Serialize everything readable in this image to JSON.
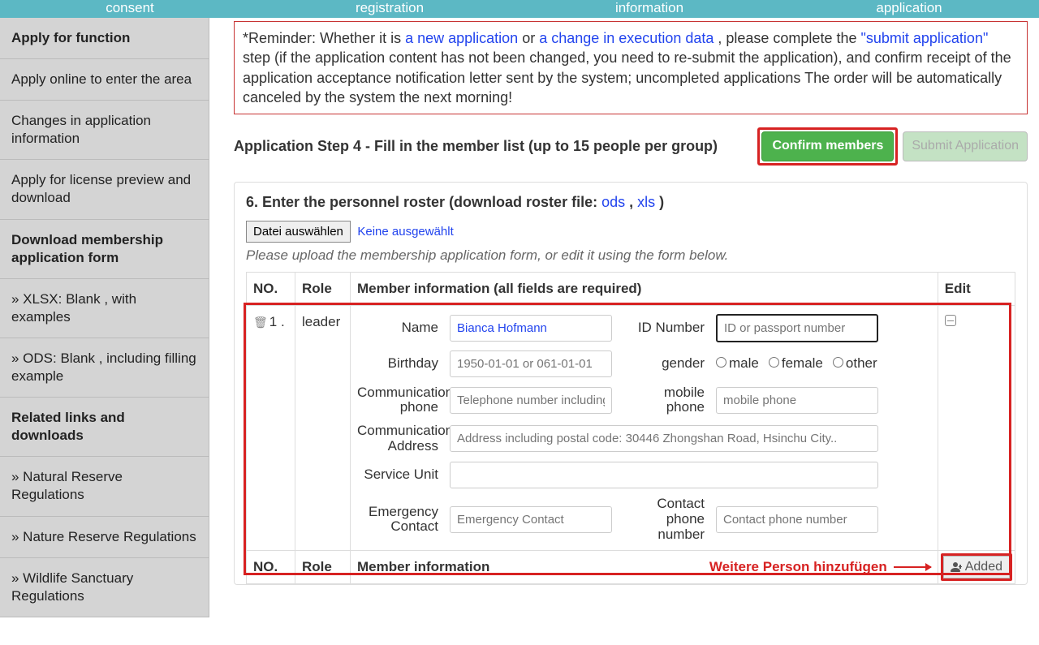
{
  "topbar": [
    "consent",
    "registration",
    "information",
    "application"
  ],
  "sidebar": {
    "items": [
      {
        "label": "Apply for function",
        "bold": true
      },
      {
        "label": "Apply online to enter the area",
        "bold": false
      },
      {
        "label": "Changes in application information",
        "bold": false
      },
      {
        "label": "Apply for license preview and download",
        "bold": false
      },
      {
        "label": "Download membership application form",
        "bold": true
      },
      {
        "label": "» XLSX: Blank , with examples",
        "bold": false
      },
      {
        "label": "» ODS: Blank , including filling example",
        "bold": false
      },
      {
        "label": "Related links and downloads",
        "bold": true
      },
      {
        "label": "» Natural Reserve Regulations",
        "bold": false
      },
      {
        "label": "» Nature Reserve Regulations",
        "bold": false
      },
      {
        "label": "» Wildlife Sanctuary Regulations",
        "bold": false
      }
    ]
  },
  "reminder": {
    "prefix": "*Reminder: Whether it is ",
    "link1": "a new application",
    "mid1": " or ",
    "link2": "a change in execution data",
    "mid2": " , please complete the ",
    "link3": "\"submit application\"",
    "suffix": " step (if the application content has not been changed, you need to re-submit the application), and confirm receipt of the application acceptance notification letter sent by the system; uncompleted applications The order will be automatically canceled by the system the next morning!"
  },
  "step": {
    "title": "Application Step 4 - Fill in the member list (up to 15 people per group)",
    "confirm": "Confirm members",
    "submit": "Submit Application"
  },
  "panel": {
    "title_prefix": "6. Enter the personnel roster (download roster file: ",
    "ods": "ods",
    "sep": " , ",
    "xls": "xls",
    "suffix": " )",
    "file_btn": "Datei auswählen",
    "file_status": "Keine ausgewählt",
    "hint": "Please upload the membership application form, or edit it using the form below."
  },
  "table": {
    "headers": {
      "no": "NO.",
      "role": "Role",
      "info": "Member information (all fields are required)",
      "edit": "Edit"
    },
    "footer_info": "Member information",
    "row": {
      "no": "1 .",
      "role": "leader"
    },
    "labels": {
      "name": "Name",
      "id": "ID Number",
      "birthday": "Birthday",
      "gender": "gender",
      "comm_phone": "Communication phone",
      "mobile": "mobile phone",
      "address": "Communication Address",
      "service": "Service Unit",
      "emerg": "Emergency Contact",
      "contact_phone": "Contact phone number"
    },
    "values": {
      "name": "Bianca Hofmann"
    },
    "placeholders": {
      "id": "ID or passport number",
      "birthday": "1950-01-01 or 061-01-01",
      "comm_phone": "Telephone number including",
      "mobile": "mobile phone",
      "address": "Address including postal code: 30446 Zhongshan Road, Hsinchu City..",
      "emerg": "Emergency Contact",
      "contact_phone": "Contact phone number"
    },
    "gender_opts": {
      "male": "male",
      "female": "female",
      "other": "other"
    }
  },
  "annot": {
    "text": "Weitere Person hinzufügen",
    "added": "Added"
  }
}
